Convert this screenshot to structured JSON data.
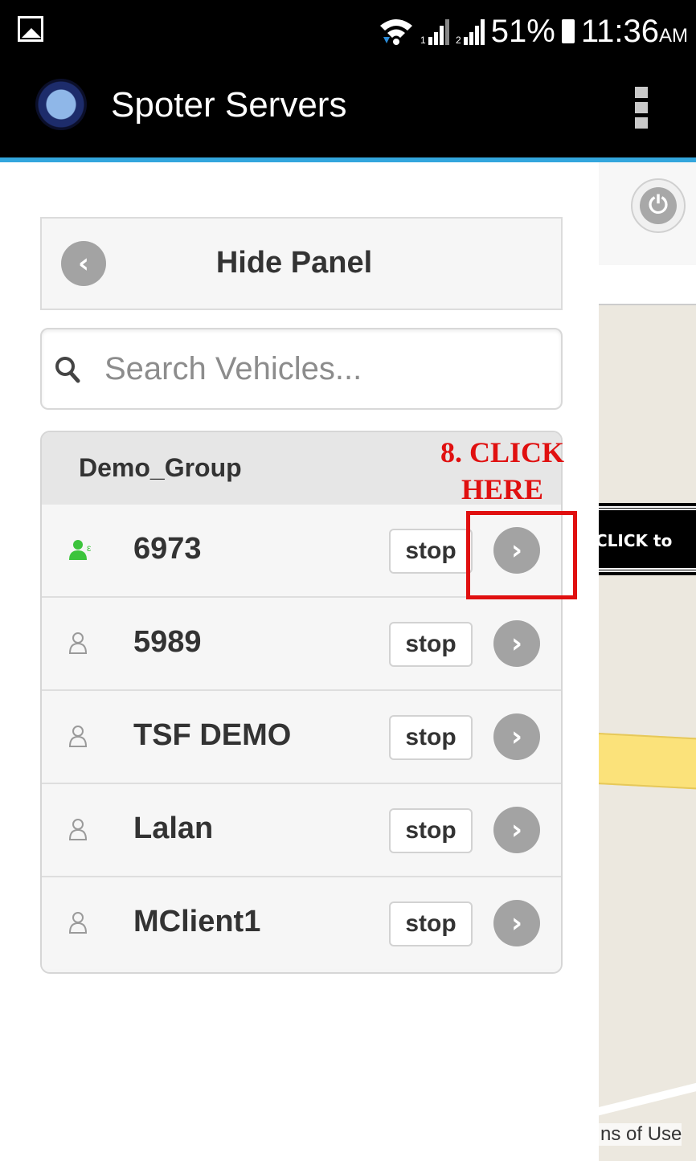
{
  "status_bar": {
    "battery": "51%",
    "time": "11:36",
    "ampm": "AM"
  },
  "app_bar": {
    "title": "Spoter Servers"
  },
  "panel": {
    "hide_label": "Hide Panel",
    "search_placeholder": "Search Vehicles...",
    "group_name": "Demo_Group",
    "vehicles": [
      {
        "name": "6973",
        "stop_label": "stop",
        "status": "online"
      },
      {
        "name": "5989",
        "stop_label": "stop",
        "status": "offline"
      },
      {
        "name": "TSF DEMO",
        "stop_label": "stop",
        "status": "offline"
      },
      {
        "name": "Lalan",
        "stop_label": "stop",
        "status": "offline"
      },
      {
        "name": "MClient1",
        "stop_label": "stop",
        "status": "offline"
      }
    ]
  },
  "map": {
    "terms_text": "ns of Use"
  },
  "callout": {
    "text": "CLICK  to"
  },
  "annotation": {
    "line1": "8. CLICK",
    "line2": "HERE",
    "color": "#e01010"
  },
  "colors": {
    "accent": "#33a6dd",
    "online_icon": "#3cc43c",
    "offline_icon": "#9a9a9a"
  }
}
